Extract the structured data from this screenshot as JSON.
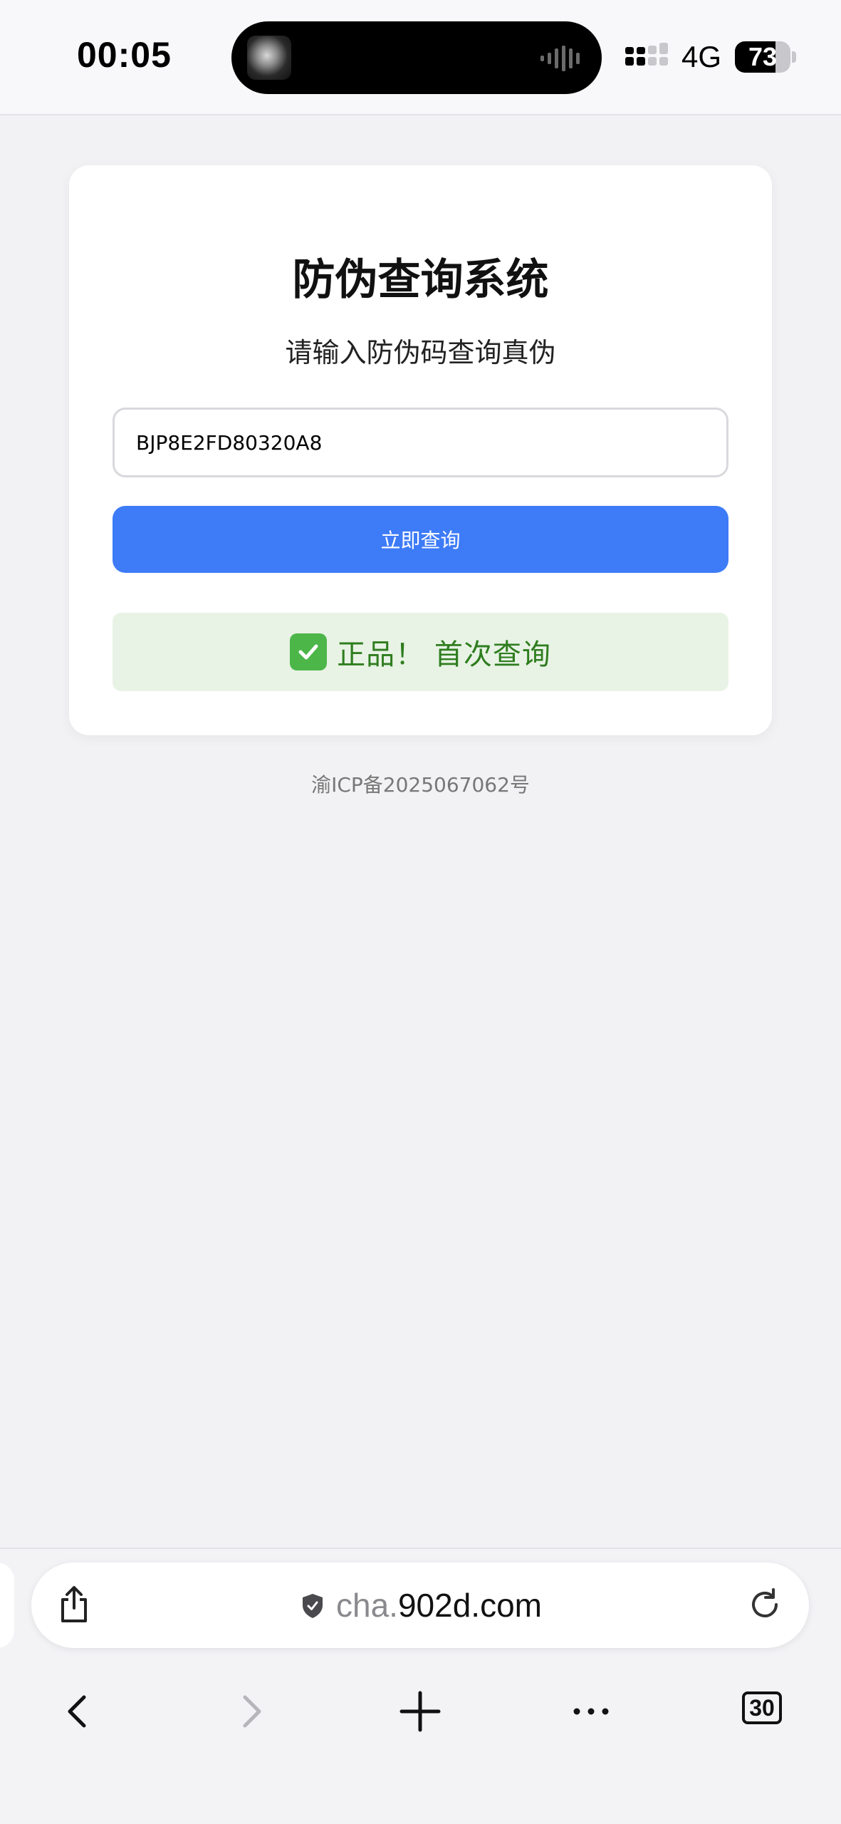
{
  "status_bar": {
    "time": "00:05",
    "network": "4G",
    "battery_level": "73",
    "battery_fraction": 0.73
  },
  "card": {
    "title": "防伪查询系统",
    "subtitle": "请输入防伪码查询真伪",
    "code_input": {
      "value": "BJP8E2FD80320A8",
      "placeholder": ""
    },
    "query_button_label": "立即查询",
    "result": {
      "text": "正品！ 首次查询",
      "icon": "check-mark-button-icon",
      "color": "#2f7d1f",
      "background": "#e8f3e5"
    }
  },
  "footer": {
    "icp": "渝ICP备2025067062号"
  },
  "browser": {
    "url_prefix": "cha.",
    "url_domain": "902d.com",
    "tabs_count": "30",
    "accent_color": "#3d7bf7"
  }
}
